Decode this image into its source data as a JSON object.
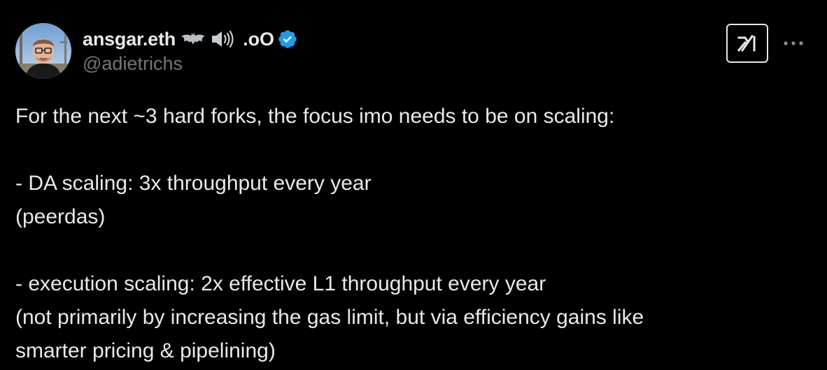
{
  "author": {
    "display_name": "ansgar.eth",
    "name_suffix": ".oO",
    "handle": "@adietrichs",
    "emoji_icons": [
      "bat-icon",
      "speaker-icon"
    ],
    "verified": true
  },
  "actions": {
    "grok_icon": "grok-icon",
    "more_icon": "more-dots-icon"
  },
  "tweet": {
    "lines": [
      "For the next ~3 hard forks, the focus imo needs to be on scaling:",
      "",
      "- DA scaling: 3x throughput every year",
      "(peerdas)",
      "",
      "- execution scaling: 2x effective L1 throughput every year",
      "(not primarily by increasing the gas limit, but via efficiency gains like",
      "smarter pricing & pipelining)"
    ]
  },
  "colors": {
    "background": "#000000",
    "text_primary": "#e7e9ea",
    "text_secondary": "#71767b",
    "verified_blue": "#1d9bf0"
  }
}
